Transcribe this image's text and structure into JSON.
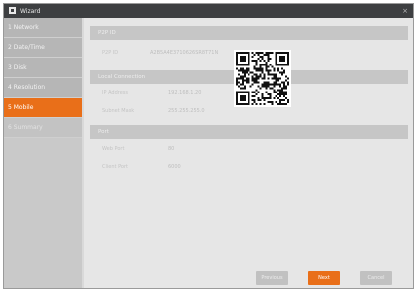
{
  "window": {
    "title": "Wizard",
    "close_symbol": "×"
  },
  "sidebar": {
    "items": [
      {
        "label": "1 Network"
      },
      {
        "label": "2 Date/Time"
      },
      {
        "label": "3 Disk"
      },
      {
        "label": "4 Resolution"
      },
      {
        "label": "5 Mobile",
        "active": true
      },
      {
        "label": "6 Summary"
      }
    ]
  },
  "main": {
    "p2p_section": "P2P ID",
    "p2p_id_label": "P2P ID",
    "p2p_id_value": "A2B5A4E3710626SR8T71N",
    "local_section": "Local Connection",
    "ip_label": "IP Address",
    "ip_value": "192.168.1.20",
    "subnet_label": "Subnet Mask",
    "subnet_value": "255.255.255.0",
    "port_section": "Port",
    "web_port_label": "Web Port",
    "web_port_value": "80",
    "client_port_label": "Client Port",
    "client_port_value": "6000"
  },
  "buttons": {
    "previous": "Previous",
    "next": "Next",
    "cancel": "Cancel"
  },
  "colors": {
    "accent": "#e96f19",
    "titlebar": "#3d3f41",
    "background": "#e6e6e6"
  }
}
